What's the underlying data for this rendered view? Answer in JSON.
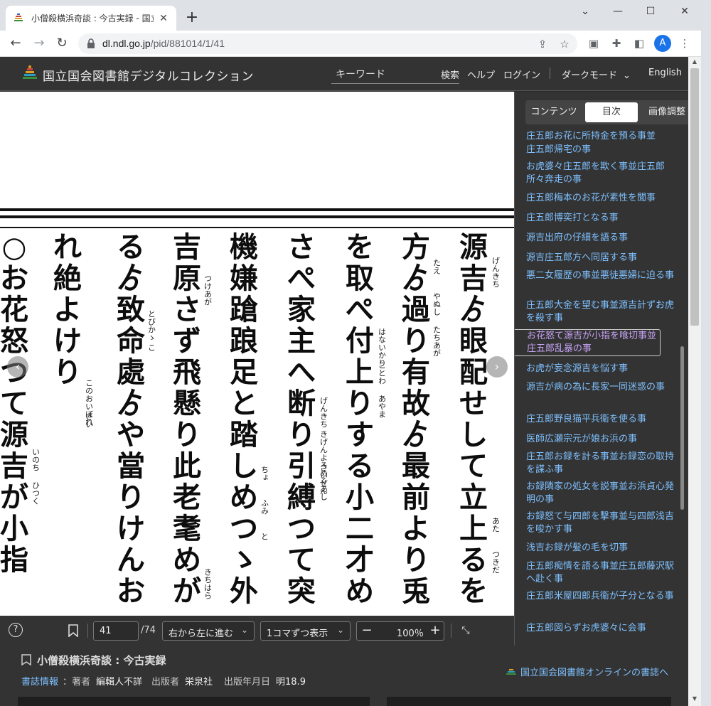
{
  "browser": {
    "tab_title": "小僧殺横浜奇談 : 今古実録 - 国立",
    "url_host": "dl.ndl.go.jp",
    "url_path": "/pid/881014/1/41",
    "avatar_letter": "A"
  },
  "header": {
    "site_name": "国立国会図書館デジタルコレクション",
    "keyword_placeholder": "キーワード",
    "search_label": "検索",
    "help_label": "ヘルプ",
    "login_label": "ログイン",
    "darkmode_label": "ダークモード",
    "english_label": "English"
  },
  "viewer": {
    "page_value": "41",
    "page_total": "/74",
    "direction": "右から左に進む",
    "display_mode": "1コマずつ表示",
    "zoom": "100％"
  },
  "panel": {
    "tabs": [
      "コンテンツ",
      "目次",
      "画像調整"
    ],
    "active_tab": "目次",
    "toc": [
      "庄五郎お花に所持金を預る事並",
      "庄五郎帰宅の事",
      "お虎婆々庄五郎を欺く事並庄五郎所々奔走の事",
      "庄五郎梅本のお花が素性を聞事",
      "庄五郎博奕打となる事",
      "源吉出府の仔細を語る事",
      "源吉庄五郎方へ同居する事",
      "悪二女履歴の事並悪徒悪婦に迫る事",
      "庄五郎大金を望む事並源吉計ずお虎を殺す事",
      "お花怒て源吉が小指を喰切事並庄五郎乱暴の事",
      "お虎が妄念源吉を悩す事",
      "源吉が病の為に長家一同迷惑の事",
      "庄五郎野良猫平兵衛を使る事",
      "医師広瀬宗元が娘お浜の事",
      "庄五郎お録を計る事並お録恋の取持を謀ふ事",
      "お録隣家の処女を説事並お浜貞心発明の事",
      "お録怒て与四郎を撃事並与四郎浅吉を唆かす事",
      "浅吉お録が髪の毛を切事",
      "庄五郎痴情を語る事並庄五郎藤沢駅へ赴く事",
      "庄五郎米屋四郎兵衛が子分となる事",
      "庄五郎図らずお虎婆々に会事"
    ]
  },
  "info": {
    "title": "小僧殺横浜奇談 : 今古実録",
    "biblio_link": "書誌情報",
    "author_key": "：著者",
    "author_val": "編輯人不詳",
    "publisher_key": "出版者",
    "publisher_val": "栄泉社",
    "date_key": "出版年月日",
    "date_val": "明18.9",
    "online_link": "国立国会図書館オンラインの書誌へ"
  },
  "page_image": {
    "columns": [
      "源吉ゟ眼配せして立上るをお",
      "方ゟ過り有故ゟ最前より兎角",
      "を取ぺ付上りする小二才め女",
      "さぺ家主へ断り引縛つて突出",
      "機嫌蹌踉足と踏しめつゝ外面",
      "吉原さず飛懸り此老耄めが",
      "るゟ致命處ゟや當りけんおぼ",
      "れ絶よけり",
      "○お花怒つて源吉が小指"
    ],
    "furigana": [
      "げんきち",
      "たちあが",
      "あやま",
      "さいぜん",
      "と",
      "つけあが",
      "こ",
      "さい",
      "ひつく",
      "つきだ",
      "やぬし",
      "ことわ",
      "きげんよろめくあし",
      "ふみ",
      "きちはら",
      "とびかゝ",
      "このおいぼれ",
      "いのち",
      "あた",
      "たえ",
      "はないかり",
      "げんきち",
      "ちょ"
    ]
  }
}
